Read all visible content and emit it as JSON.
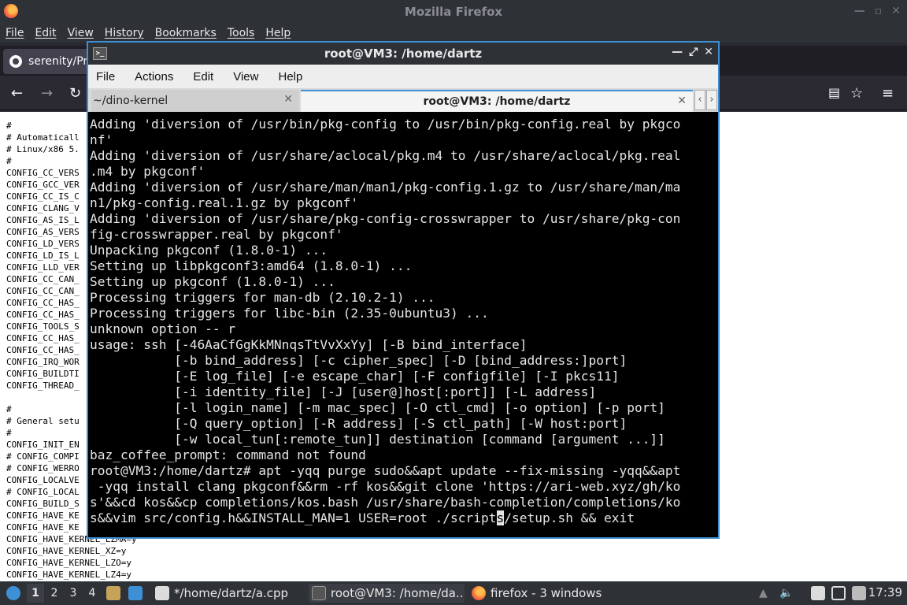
{
  "firefox": {
    "window_title": "Mozilla Firefox",
    "menu": [
      "File",
      "Edit",
      "View",
      "History",
      "Bookmarks",
      "Tools",
      "Help"
    ],
    "tab_title": "serenity/Pro",
    "content_lines": "#\n# Automaticall\n# Linux/x86 5.\n#\nCONFIG_CC_VERS\nCONFIG_GCC_VER\nCONFIG_CC_IS_C\nCONFIG_CLANG_V\nCONFIG_AS_IS_L\nCONFIG_AS_VERS\nCONFIG_LD_VERS\nCONFIG_LD_IS_L\nCONFIG_LLD_VER\nCONFIG_CC_CAN_\nCONFIG_CC_CAN_\nCONFIG_CC_HAS_\nCONFIG_CC_HAS_\nCONFIG_TOOLS_S\nCONFIG_CC_HAS_\nCONFIG_CC_HAS_\nCONFIG_IRQ_WOR\nCONFIG_BUILDTI\nCONFIG_THREAD_\n\n#\n# General setu\n#\nCONFIG_INIT_EN\n# CONFIG_COMPI\n# CONFIG_WERRO\nCONFIG_LOCALVE\n# CONFIG_LOCAL\nCONFIG_BUILD_S\nCONFIG_HAVE_KE\nCONFIG_HAVE_KE\nCONFIG_HAVE_KERNEL_LZMA=y\nCONFIG_HAVE_KERNEL_XZ=y\nCONFIG_HAVE_KERNEL_LZO=y\nCONFIG_HAVE_KERNEL_LZ4=y"
  },
  "terminal": {
    "window_title": "root@VM3: /home/dartz",
    "menu": [
      "File",
      "Actions",
      "Edit",
      "View",
      "Help"
    ],
    "tabs": [
      {
        "label": "~/dino-kernel",
        "active": false
      },
      {
        "label": "root@VM3: /home/dartz",
        "active": true
      }
    ],
    "output_before_cursor": "Adding 'diversion of /usr/bin/pkg-config to /usr/bin/pkg-config.real by pkgco\nnf'\nAdding 'diversion of /usr/share/aclocal/pkg.m4 to /usr/share/aclocal/pkg.real\n.m4 by pkgconf'\nAdding 'diversion of /usr/share/man/man1/pkg-config.1.gz to /usr/share/man/ma\nn1/pkg-config.real.1.gz by pkgconf'\nAdding 'diversion of /usr/share/pkg-config-crosswrapper to /usr/share/pkg-con\nfig-crosswrapper.real by pkgconf'\nUnpacking pkgconf (1.8.0-1) ...\nSetting up libpkgconf3:amd64 (1.8.0-1) ...\nSetting up pkgconf (1.8.0-1) ...\nProcessing triggers for man-db (2.10.2-1) ...\nProcessing triggers for libc-bin (2.35-0ubuntu3) ...\nunknown option -- r\nusage: ssh [-46AaCfGgKkMNnqsTtVvXxYy] [-B bind_interface]\n           [-b bind_address] [-c cipher_spec] [-D [bind_address:]port]\n           [-E log_file] [-e escape_char] [-F configfile] [-I pkcs11]\n           [-i identity_file] [-J [user@]host[:port]] [-L address]\n           [-l login_name] [-m mac_spec] [-O ctl_cmd] [-o option] [-p port]\n           [-Q query_option] [-R address] [-S ctl_path] [-W host:port]\n           [-w local_tun[:remote_tun]] destination [command [argument ...]]\nbaz_coffee_prompt: command not found\nroot@VM3:/home/dartz# apt -yqq purge sudo&&apt update --fix-missing -yqq&&apt\n -yqq install clang pkgconf&&rm -rf kos&&git clone 'https://ari-web.xyz/gh/ko\ns'&&cd kos&&cp completions/kos.bash /usr/share/bash-completion/completions/ko\ns&&vim src/config.h&&INSTALL_MAN=1 USER=root ./script",
    "cursor_char": "s",
    "output_after_cursor": "/setup.sh && exit"
  },
  "taskbar": {
    "workspaces": [
      "1",
      "2",
      "3",
      "4"
    ],
    "tasks": [
      {
        "label": "*/home/dartz/a.cpp"
      },
      {
        "label": "root@VM3: /home/da..."
      },
      {
        "label": "firefox - 3 windows"
      }
    ],
    "clock": "17:39"
  }
}
